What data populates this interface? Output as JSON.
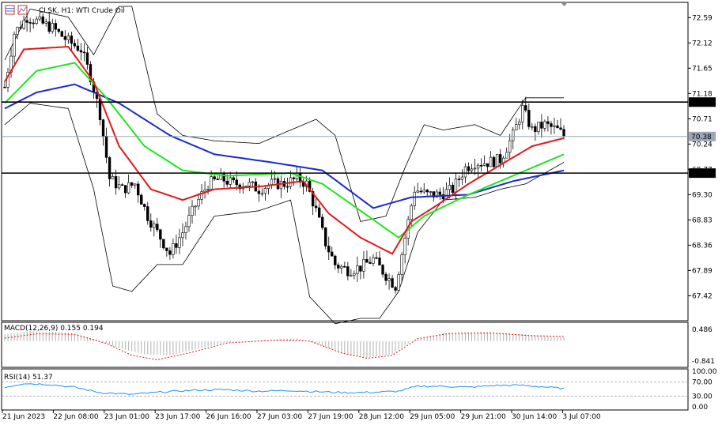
{
  "header": {
    "title": "CLSK, H1:  WTI Crude Oil",
    "icon_grid": "grid-icon",
    "icon_indicator": "indicator-icon"
  },
  "colors": {
    "ema_fast": "#e31919",
    "ema_mid": "#1ee61e",
    "ema_slow": "#1a2ad1",
    "bands": "#000000",
    "macd_hist": "#b0b0b0",
    "macd_signal": "#e31919",
    "rsi": "#1e90ff"
  },
  "price_axis": {
    "ticks": [
      "72.59",
      "72.12",
      "71.65",
      "71.18",
      "70.71",
      "70.24",
      "69.77",
      "69.30",
      "68.83",
      "68.36",
      "67.89",
      "67.42"
    ],
    "ylim": [
      67.0,
      72.8
    ],
    "resistance": {
      "label": "71.02",
      "value": 71.02
    },
    "support": {
      "label": "69.70",
      "value": 69.7
    },
    "last": {
      "label": "70.38",
      "value": 70.38
    }
  },
  "time_axis": {
    "labels": [
      "21 Jun 2023",
      "22 Jun 08:00",
      "23 Jun 01:00",
      "23 Jun 17:00",
      "26 Jun 16:00",
      "27 Jun 03:00",
      "27 Jun 19:00",
      "28 Jun 12:00",
      "29 Jun 05:00",
      "29 Jun 21:00",
      "30 Jun 14:00",
      "3 Jul 07:00"
    ]
  },
  "macd": {
    "title": "MACD(12,26,9) 0.155 0.194",
    "ticks": [
      "0.486",
      "-0.841"
    ],
    "ylim": [
      -1.0,
      0.65
    ]
  },
  "rsi": {
    "title": "RSI(14) 51.37",
    "ticks": [
      "100.00",
      "70.00",
      "30.00",
      "0.00"
    ],
    "ylim": [
      0,
      100
    ],
    "levels": [
      70,
      30
    ]
  },
  "chart_data": {
    "type": "candlestick",
    "title": "CLSK, H1:  WTI Crude Oil",
    "xlabel": "",
    "ylabel": "",
    "anchors": [
      [
        0,
        71.3
      ],
      [
        3,
        72.3
      ],
      [
        7,
        72.6
      ],
      [
        15,
        72.4
      ],
      [
        20,
        72.15
      ],
      [
        24,
        72.0
      ],
      [
        27,
        71.5
      ],
      [
        30,
        70.8
      ],
      [
        33,
        69.6
      ],
      [
        37,
        69.4
      ],
      [
        41,
        69.5
      ],
      [
        45,
        68.9
      ],
      [
        49,
        68.5
      ],
      [
        52,
        68.2
      ],
      [
        56,
        68.6
      ],
      [
        60,
        69.1
      ],
      [
        64,
        69.5
      ],
      [
        68,
        69.6
      ],
      [
        72,
        69.5
      ],
      [
        76,
        69.5
      ],
      [
        80,
        69.4
      ],
      [
        84,
        69.5
      ],
      [
        88,
        69.5
      ],
      [
        92,
        69.6
      ],
      [
        95,
        69.5
      ],
      [
        98,
        69.0
      ],
      [
        101,
        68.4
      ],
      [
        104,
        68.0
      ],
      [
        108,
        67.9
      ],
      [
        112,
        67.95
      ],
      [
        116,
        68.1
      ],
      [
        120,
        67.8
      ],
      [
        123,
        67.6
      ],
      [
        126,
        68.5
      ],
      [
        129,
        69.4
      ],
      [
        133,
        69.3
      ],
      [
        137,
        69.3
      ],
      [
        141,
        69.4
      ],
      [
        145,
        69.8
      ],
      [
        148,
        69.9
      ],
      [
        152,
        69.9
      ],
      [
        156,
        69.95
      ],
      [
        160,
        70.4
      ],
      [
        163,
        70.9
      ],
      [
        166,
        70.5
      ],
      [
        170,
        70.6
      ],
      [
        174,
        70.5
      ],
      [
        176,
        70.4
      ]
    ],
    "ema_fast_series": [
      [
        0,
        71.4
      ],
      [
        6,
        72.0
      ],
      [
        20,
        72.05
      ],
      [
        28,
        71.4
      ],
      [
        36,
        70.2
      ],
      [
        46,
        69.4
      ],
      [
        56,
        69.2
      ],
      [
        66,
        69.4
      ],
      [
        80,
        69.45
      ],
      [
        94,
        69.55
      ],
      [
        102,
        68.95
      ],
      [
        112,
        68.5
      ],
      [
        122,
        68.2
      ],
      [
        128,
        68.8
      ],
      [
        136,
        69.1
      ],
      [
        146,
        69.5
      ],
      [
        156,
        69.85
      ],
      [
        166,
        70.2
      ],
      [
        176,
        70.35
      ]
    ],
    "ema_mid_series": [
      [
        0,
        71.0
      ],
      [
        10,
        71.6
      ],
      [
        22,
        71.75
      ],
      [
        32,
        71.1
      ],
      [
        44,
        70.2
      ],
      [
        56,
        69.75
      ],
      [
        70,
        69.65
      ],
      [
        90,
        69.7
      ],
      [
        100,
        69.5
      ],
      [
        112,
        69.0
      ],
      [
        124,
        68.5
      ],
      [
        132,
        68.9
      ],
      [
        146,
        69.3
      ],
      [
        158,
        69.6
      ],
      [
        170,
        69.9
      ],
      [
        176,
        70.05
      ]
    ],
    "ema_slow_series": [
      [
        0,
        70.9
      ],
      [
        10,
        71.2
      ],
      [
        22,
        71.35
      ],
      [
        36,
        71.0
      ],
      [
        52,
        70.4
      ],
      [
        66,
        70.05
      ],
      [
        84,
        69.9
      ],
      [
        100,
        69.75
      ],
      [
        116,
        69.05
      ],
      [
        128,
        69.25
      ],
      [
        146,
        69.3
      ],
      [
        160,
        69.55
      ],
      [
        176,
        69.75
      ]
    ],
    "bb_upper": [
      [
        0,
        71.8
      ],
      [
        8,
        72.75
      ],
      [
        20,
        72.6
      ],
      [
        28,
        71.9
      ],
      [
        36,
        72.8
      ],
      [
        40,
        72.8
      ],
      [
        48,
        70.8
      ],
      [
        56,
        70.4
      ],
      [
        66,
        70.3
      ],
      [
        80,
        70.25
      ],
      [
        90,
        70.5
      ],
      [
        98,
        70.7
      ],
      [
        104,
        70.4
      ],
      [
        112,
        68.8
      ],
      [
        120,
        68.9
      ],
      [
        126,
        69.8
      ],
      [
        132,
        70.6
      ],
      [
        138,
        70.5
      ],
      [
        148,
        70.6
      ],
      [
        156,
        70.4
      ],
      [
        164,
        71.1
      ],
      [
        176,
        71.1
      ]
    ],
    "bb_lower": [
      [
        0,
        70.6
      ],
      [
        8,
        71.0
      ],
      [
        20,
        70.9
      ],
      [
        28,
        69.4
      ],
      [
        34,
        67.6
      ],
      [
        40,
        67.5
      ],
      [
        48,
        68.0
      ],
      [
        56,
        68.0
      ],
      [
        66,
        68.9
      ],
      [
        80,
        69.0
      ],
      [
        90,
        69.2
      ],
      [
        96,
        67.4
      ],
      [
        104,
        66.9
      ],
      [
        112,
        67.0
      ],
      [
        118,
        67.0
      ],
      [
        124,
        67.5
      ],
      [
        130,
        68.6
      ],
      [
        138,
        69.2
      ],
      [
        148,
        69.25
      ],
      [
        156,
        69.4
      ],
      [
        164,
        69.5
      ],
      [
        176,
        69.9
      ]
    ],
    "macd_hist": [
      [
        0,
        0.28
      ],
      [
        8,
        0.42
      ],
      [
        20,
        0.36
      ],
      [
        28,
        0.1
      ],
      [
        36,
        -0.3
      ],
      [
        44,
        -0.55
      ],
      [
        52,
        -0.6
      ],
      [
        60,
        -0.35
      ],
      [
        70,
        -0.05
      ],
      [
        84,
        0.05
      ],
      [
        92,
        0.12
      ],
      [
        98,
        -0.1
      ],
      [
        106,
        -0.5
      ],
      [
        114,
        -0.7
      ],
      [
        122,
        -0.55
      ],
      [
        128,
        0.0
      ],
      [
        138,
        0.32
      ],
      [
        150,
        0.38
      ],
      [
        162,
        0.3
      ],
      [
        176,
        0.155
      ]
    ],
    "macd_signal": [
      [
        0,
        0.12
      ],
      [
        10,
        0.3
      ],
      [
        22,
        0.28
      ],
      [
        32,
        -0.1
      ],
      [
        40,
        -0.6
      ],
      [
        48,
        -0.78
      ],
      [
        58,
        -0.5
      ],
      [
        70,
        -0.08
      ],
      [
        86,
        0.04
      ],
      [
        96,
        0.0
      ],
      [
        106,
        -0.5
      ],
      [
        114,
        -0.72
      ],
      [
        122,
        -0.6
      ],
      [
        130,
        0.1
      ],
      [
        140,
        0.32
      ],
      [
        154,
        0.33
      ],
      [
        166,
        0.22
      ],
      [
        176,
        0.194
      ]
    ],
    "rsi_series": [
      [
        0,
        55
      ],
      [
        6,
        66
      ],
      [
        14,
        63
      ],
      [
        22,
        55
      ],
      [
        30,
        40
      ],
      [
        40,
        35
      ],
      [
        50,
        42
      ],
      [
        60,
        47
      ],
      [
        70,
        48
      ],
      [
        80,
        44
      ],
      [
        90,
        46
      ],
      [
        100,
        42
      ],
      [
        108,
        40
      ],
      [
        116,
        41
      ],
      [
        124,
        44
      ],
      [
        130,
        58
      ],
      [
        138,
        58
      ],
      [
        146,
        55
      ],
      [
        154,
        60
      ],
      [
        162,
        61
      ],
      [
        170,
        56
      ],
      [
        176,
        51.37
      ]
    ]
  }
}
